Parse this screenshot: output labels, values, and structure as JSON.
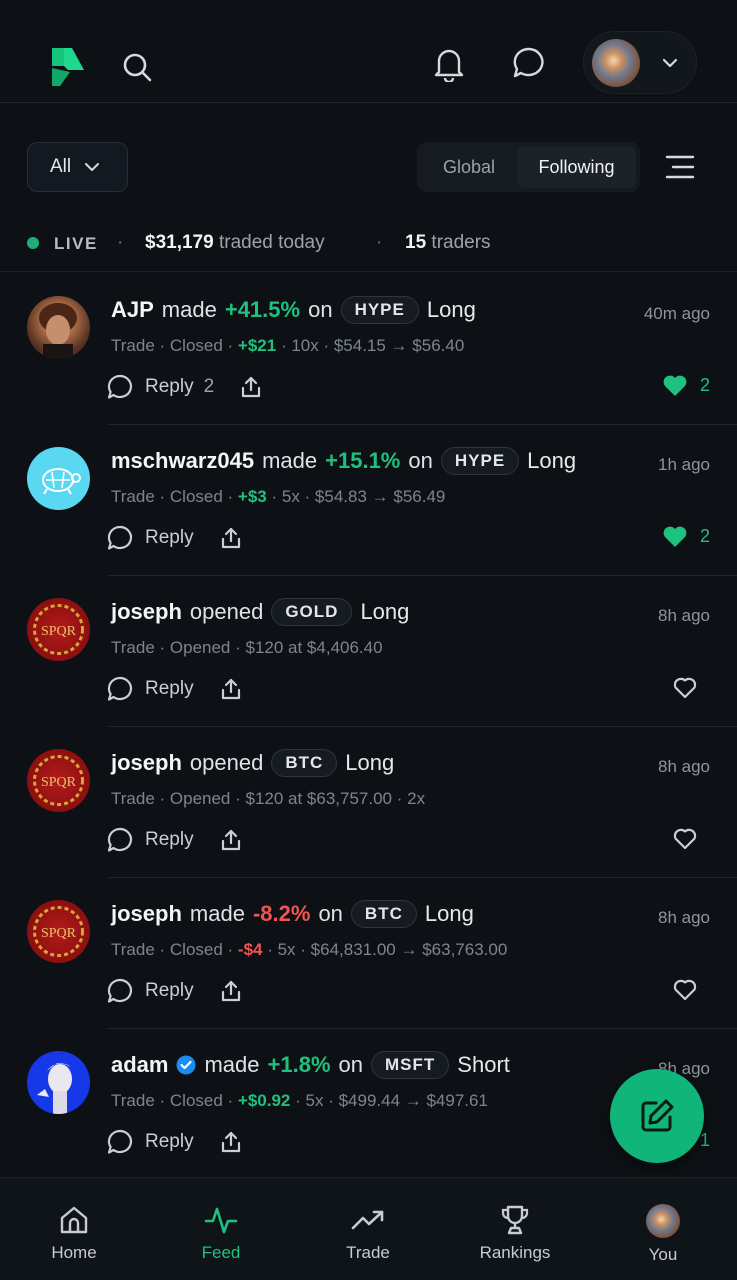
{
  "header": {
    "logo_icon": "brand-logo",
    "search_icon": "search-icon",
    "notifications_icon": "bell-icon",
    "messages_icon": "chat-bubble-icon",
    "profile_dropdown_icon": "chevron-down-icon"
  },
  "filters": {
    "all_label": "All",
    "tabs": [
      {
        "label": "Global",
        "active": false
      },
      {
        "label": "Following",
        "active": true
      }
    ],
    "menu_icon": "hamburger-filter-icon"
  },
  "live": {
    "label": "LIVE",
    "amount": "$31,179",
    "amount_suffix": "traded today",
    "traders_count": "15",
    "traders_suffix": "traders"
  },
  "posts": [
    {
      "user": "AJP",
      "verified": false,
      "verb": "made",
      "pct": "+41.5%",
      "pct_sign": "pos",
      "on": "on",
      "ticker": "HYPE",
      "side": "Long",
      "time": "40m ago",
      "detail_pre": "Trade · Closed · ",
      "detail_pnl": "+$21",
      "detail_pnl_sign": "pos",
      "detail_post": " · 10x · $54.15 → $56.40",
      "reply_label": "Reply",
      "reply_count": "2",
      "likes": "2",
      "liked": true
    },
    {
      "user": "mschwarz045",
      "verified": false,
      "verb": "made",
      "pct": "+15.1%",
      "pct_sign": "pos",
      "on": "on",
      "ticker": "HYPE",
      "side": "Long",
      "time": "1h ago",
      "detail_pre": "Trade · Closed · ",
      "detail_pnl": "+$3",
      "detail_pnl_sign": "pos",
      "detail_post": " · 5x · $54.83 → $56.49",
      "reply_label": "Reply",
      "reply_count": "",
      "likes": "2",
      "liked": true
    },
    {
      "user": "joseph",
      "verified": false,
      "verb": "opened",
      "pct": "",
      "pct_sign": "",
      "on": "",
      "ticker": "GOLD",
      "side": "Long",
      "time": "8h ago",
      "detail_pre": "Trade · Opened · $120 at $4,406.40",
      "detail_pnl": "",
      "detail_pnl_sign": "",
      "detail_post": "",
      "reply_label": "Reply",
      "reply_count": "",
      "likes": "",
      "liked": false
    },
    {
      "user": "joseph",
      "verified": false,
      "verb": "opened",
      "pct": "",
      "pct_sign": "",
      "on": "",
      "ticker": "BTC",
      "side": "Long",
      "time": "8h ago",
      "detail_pre": "Trade · Opened · $120 at $63,757.00 · 2x",
      "detail_pnl": "",
      "detail_pnl_sign": "",
      "detail_post": "",
      "reply_label": "Reply",
      "reply_count": "",
      "likes": "",
      "liked": false
    },
    {
      "user": "joseph",
      "verified": false,
      "verb": "made",
      "pct": "-8.2%",
      "pct_sign": "neg",
      "on": "on",
      "ticker": "BTC",
      "side": "Long",
      "time": "8h ago",
      "detail_pre": "Trade · Closed · ",
      "detail_pnl": "-$4",
      "detail_pnl_sign": "neg",
      "detail_post": " · 5x · $64,831.00 → $63,763.00",
      "reply_label": "Reply",
      "reply_count": "",
      "likes": "",
      "liked": false
    },
    {
      "user": "adam",
      "verified": true,
      "verb": "made",
      "pct": "+1.8%",
      "pct_sign": "pos",
      "on": "on",
      "ticker": "MSFT",
      "side": "Short",
      "time": "8h ago",
      "detail_pre": "Trade · Closed · ",
      "detail_pnl": "+$0.92",
      "detail_pnl_sign": "pos",
      "detail_post": " · 5x · $499.44 → $497.61",
      "reply_label": "Reply",
      "reply_count": "",
      "likes": "1",
      "liked": true
    }
  ],
  "fab_icon": "compose-icon",
  "nav": [
    {
      "label": "Home",
      "icon": "home-icon",
      "active": false
    },
    {
      "label": "Feed",
      "icon": "pulse-icon",
      "active": true
    },
    {
      "label": "Trade",
      "icon": "trend-up-icon",
      "active": false
    },
    {
      "label": "Rankings",
      "icon": "trophy-icon",
      "active": false
    },
    {
      "label": "You",
      "icon": "avatar",
      "active": false
    }
  ],
  "colors": {
    "accent": "#1fc17f",
    "negative": "#f05454",
    "background": "#0d1115"
  }
}
